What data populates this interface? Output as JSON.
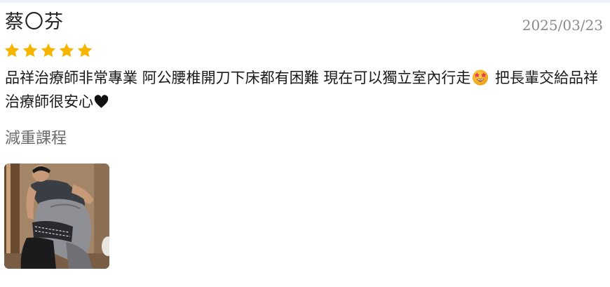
{
  "review": {
    "reviewer_name": "蔡〇芬",
    "date": "2025/03/23",
    "rating": 5,
    "text_part1": "品祥治療師非常專業 阿公腰椎開刀下床都有困難 現在可以獨立室內行走",
    "text_part2": " 把長輩交給品祥治療師很安心",
    "course": "減重課程",
    "emoji_icon": "star-struck-emoji-icon",
    "heart_icon": "black-heart-icon",
    "star_color": "#f7b500",
    "photo_alt": "therapist helping elderly patient"
  }
}
